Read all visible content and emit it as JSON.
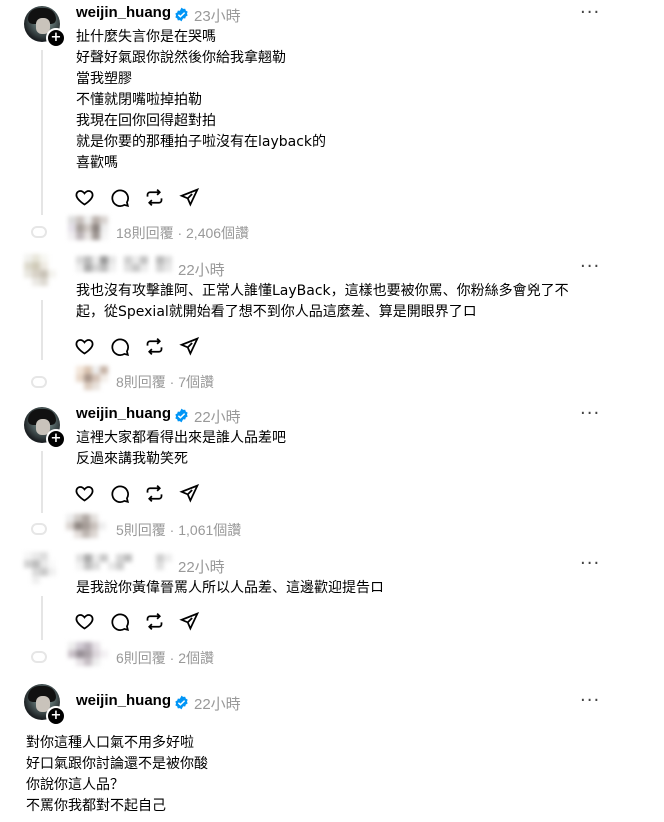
{
  "posts": [
    {
      "username": "weijin_huang",
      "time": "23小時",
      "lines": [
        "扯什麼失言你是在哭嗎",
        "好聲好氣跟你說然後你給我拿翹勒",
        "當我塑膠",
        "不懂就閉嘴啦掉拍勒",
        "我現在回你回得超對拍",
        "就是你要的那種拍子啦沒有在layback的",
        "喜歡嗎"
      ],
      "stats": "18則回覆 · 2,406個讚"
    },
    {
      "username": "",
      "time": "22小時",
      "lines": [
        "我也沒有攻擊誰阿、正常人誰懂LayBack，這樣也要被你罵、你粉絲多會兇了不",
        "起，從Spexial就開始看了想不到你人品這麼差、算是開眼界了ロ"
      ],
      "stats": "8則回覆 · 7個讚"
    },
    {
      "username": "weijin_huang",
      "time": "22小時",
      "lines": [
        "這裡大家都看得出來是誰人品差吧",
        "反過來講我勒笑死"
      ],
      "stats": "5則回覆 · 1,061個讚"
    },
    {
      "username": "",
      "time": "22小時",
      "lines": [
        "是我說你黃偉晉罵人所以人品差、這邊歡迎提告ロ"
      ],
      "stats": "6則回覆 · 2個讚"
    },
    {
      "username": "weijin_huang",
      "time": "22小時",
      "lines": [
        "對你這種人口氣不用多好啦",
        "好口氣跟你討論還不是被你酸",
        "你說你這人品？",
        "不罵你我都對不起自己"
      ],
      "stats": ""
    }
  ],
  "icons": {
    "like": "heart-icon",
    "reply": "comment-icon",
    "repost": "repost-icon",
    "share": "share-icon",
    "verified": "verified-badge-icon",
    "more": "more-icon"
  },
  "colors": {
    "verified": "#0095f6",
    "muted": "#999999"
  }
}
